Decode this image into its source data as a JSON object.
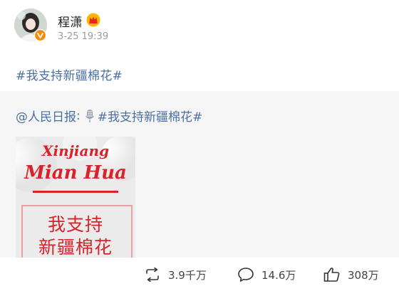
{
  "post": {
    "author": {
      "name": "程潇",
      "avatar_icon": "avatar",
      "verified_icon": "verified-badge-icon",
      "vip_icon": "crown-icon"
    },
    "timestamp": "3-25 19:39",
    "text": "#我支持新疆棉花#"
  },
  "repost": {
    "source": "@人民日报",
    "colon": ":",
    "mic_icon": "microphone-icon",
    "hashtag": "#我支持新疆棉花#",
    "image": {
      "line1": "Xinjiang",
      "line2": "Mian Hua",
      "cn_line1": "我支持",
      "cn_line2": "新疆棉花"
    }
  },
  "actions": {
    "repost_count": "3.9千万",
    "comment_count": "14.6万",
    "like_count": "308万"
  },
  "colors": {
    "link": "#4b6fa3",
    "accent_red": "#d8232a",
    "repost_bg": "#f6f6f6"
  }
}
